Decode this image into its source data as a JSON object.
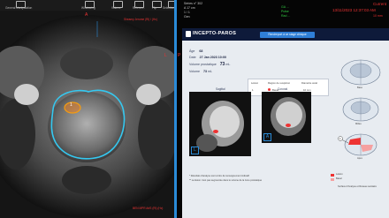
{
  "toolbar": {
    "items": [
      "General Manipulation",
      "Windowing",
      "Volume",
      "Referen...",
      "Flip",
      "Selection Bas..."
    ]
  },
  "viewer": {
    "orientation_top": "A",
    "orientation_right": "L",
    "overlay_top_right": "Sheamy Jerome (Rl) / (Hc)",
    "overlay_bottom_right": "BEN MPR ArtS (Rl) (Hc)",
    "lesion_marker": "1"
  },
  "right_viewer": {
    "top_left_lines": [
      "Séries n° 302",
      "A 17 cm",
      "1 / 1",
      "Gen"
    ],
    "top_right_lines": [
      "Current",
      "13/11/2023 12:37:03 AM",
      "10 mm"
    ],
    "green_lines": [
      "GA ...",
      "Pulse",
      "Rad ..."
    ],
    "bottom_right_lines": [
      "Current",
      "Patient",
      "10 mm"
    ],
    "side_markers": [
      "P",
      "R"
    ]
  },
  "report": {
    "brand": "INCEPTO-PAROS",
    "send_button": "Rendreport à ce stage clinique",
    "age_label": "Âge",
    "age_value": "68",
    "date_label": "Date",
    "date_value": "27 Jan 2023 10:00",
    "volume_label": "Volume prostatique",
    "volume_value": "73",
    "volume_unit": "mL",
    "psad_label": "Volume",
    "psad_value": "73",
    "psad_unit": "mL",
    "table_headers": [
      "Lésion",
      "Région de suspicion",
      "Diamètre axial"
    ],
    "table_row": [
      "1",
      "Basal",
      "10 mm"
    ],
    "view_sagittal": "Sagittal",
    "view_coronal": "Coronal",
    "corner_left": "L",
    "corner_right": "A",
    "diagram_labels": [
      "Base",
      "Milieu",
      "Apex"
    ],
    "diagram_marker": "1",
    "legend": [
      "Lésion",
      "Basal"
    ],
    "footnotes": [
      "* Résultats d'analyse sont à titre de renseignement indicatif",
      "** La lésion n'est pas segmentée dans le volume de la zone prostatique"
    ],
    "footer_right": "Surface d'Analyse et Réseau sanitaire"
  }
}
